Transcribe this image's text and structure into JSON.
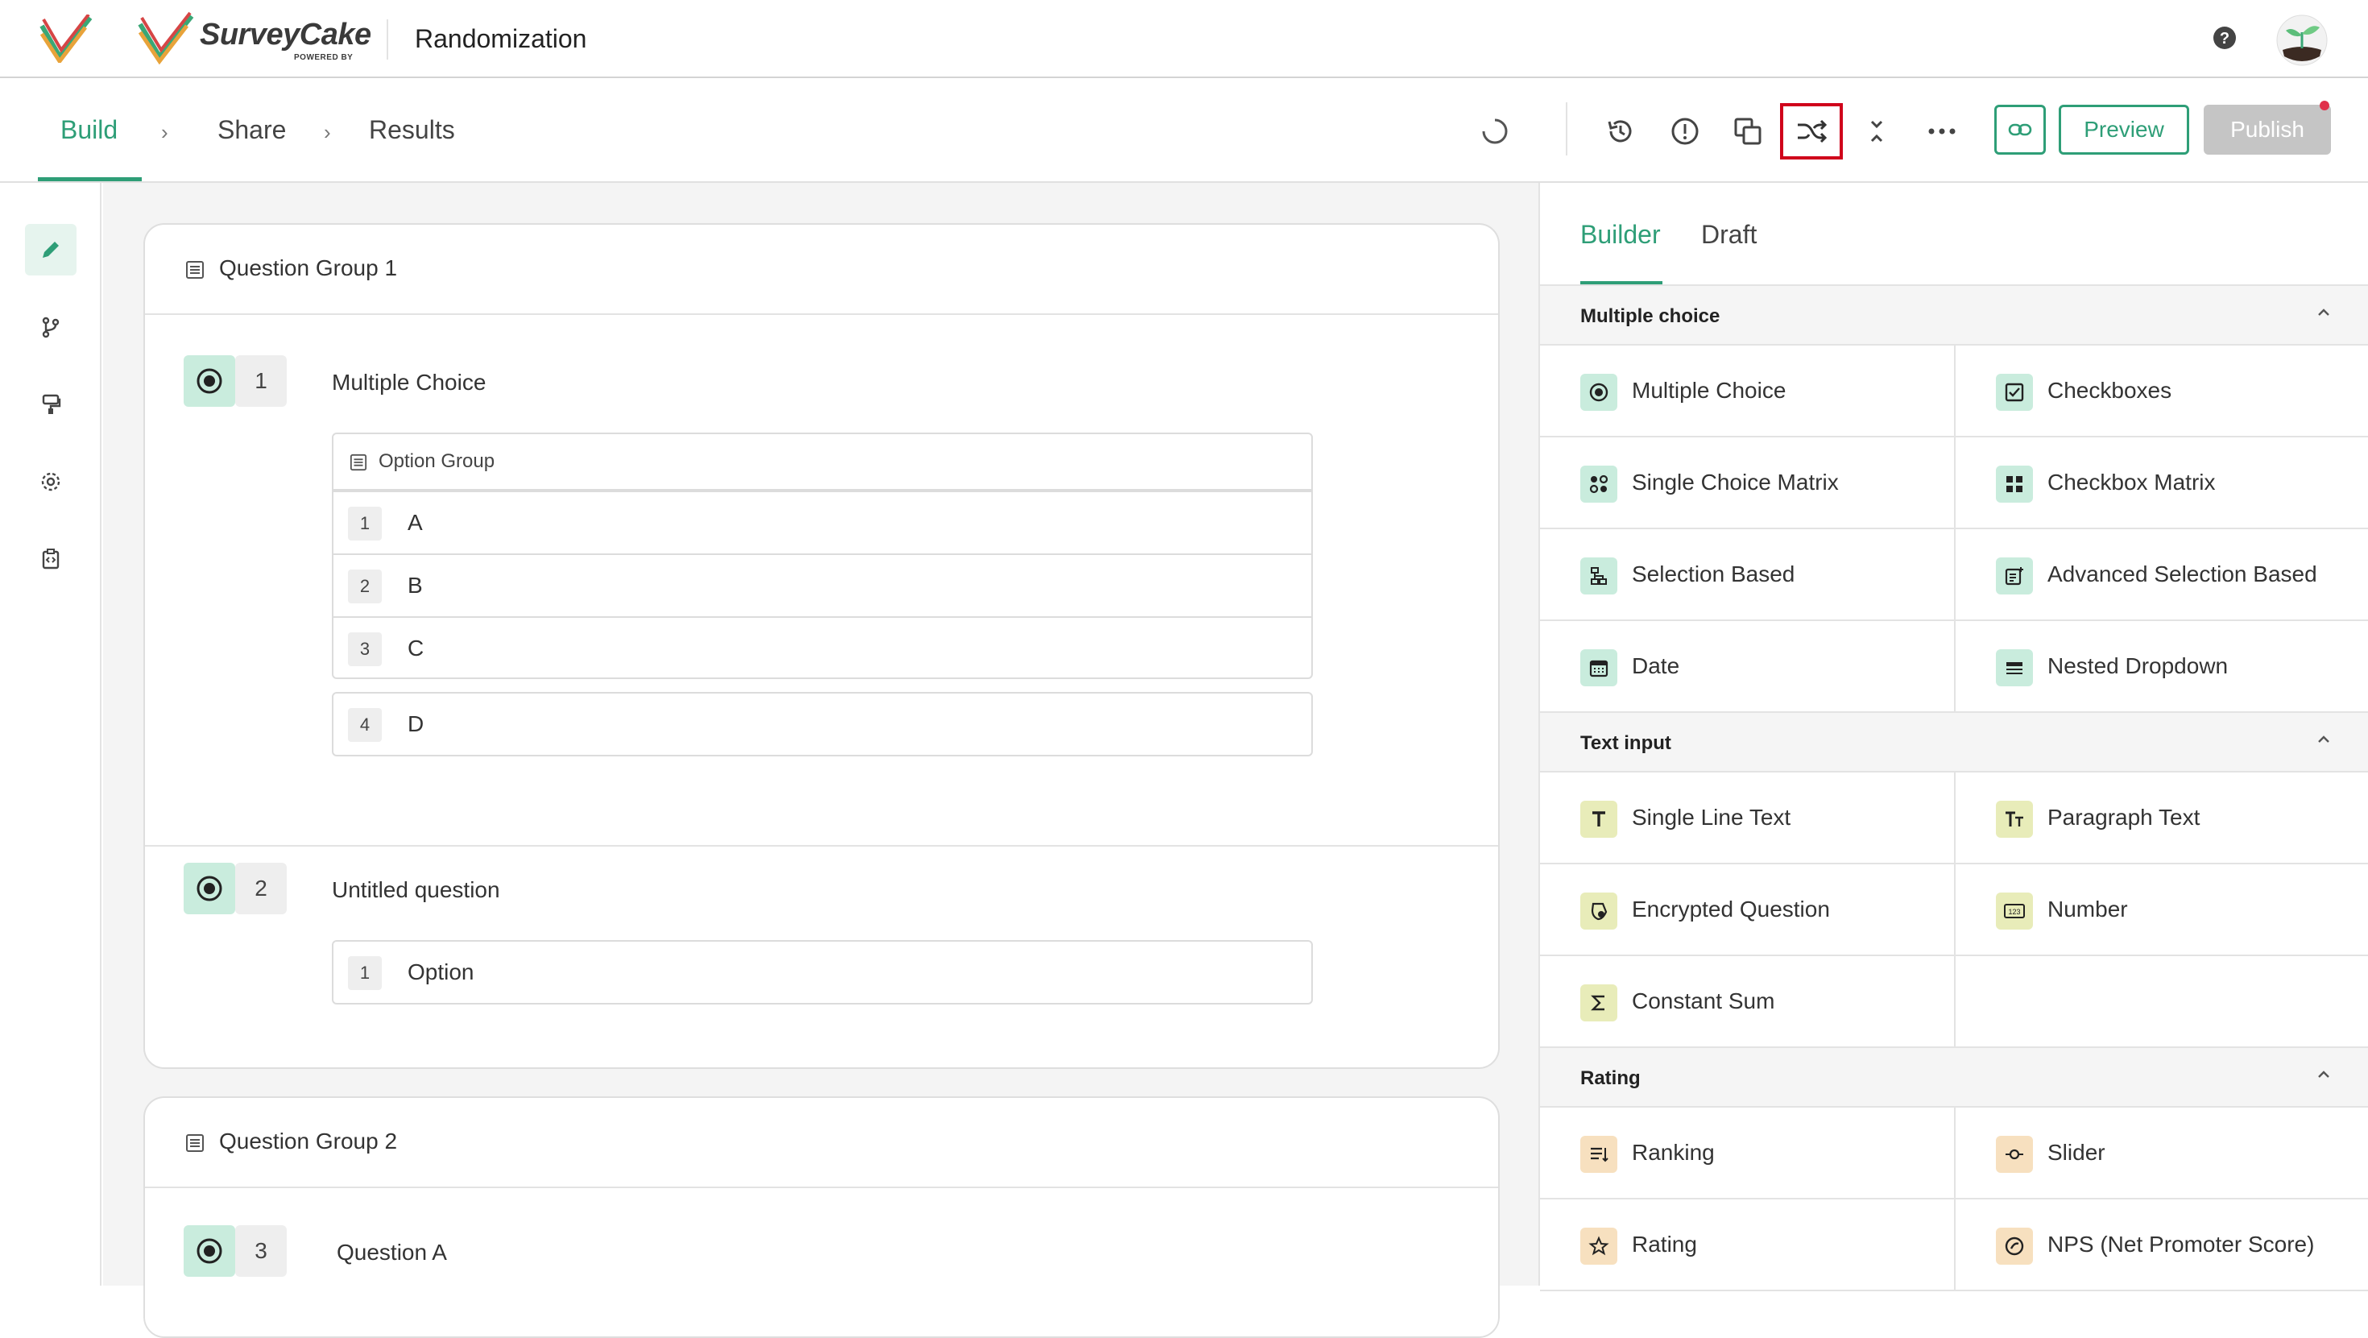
{
  "header": {
    "brand_name": "SurveyCake",
    "brand_sub": "POWERED BY",
    "page_title": "Randomization"
  },
  "nav": {
    "steps": [
      "Build",
      "Share",
      "Results"
    ],
    "preview_label": "Preview",
    "publish_label": "Publish"
  },
  "canvas": {
    "groups": [
      {
        "title": "Question Group 1",
        "questions": [
          {
            "number": "1",
            "title": "Multiple Choice",
            "option_group_label": "Option Group",
            "group_options": [
              {
                "num": "1",
                "text": "A"
              },
              {
                "num": "2",
                "text": "B"
              },
              {
                "num": "3",
                "text": "C"
              }
            ],
            "extra_option": {
              "num": "4",
              "text": "D"
            }
          },
          {
            "number": "2",
            "title": "Untitled question",
            "options": [
              {
                "num": "1",
                "text": "Option"
              }
            ]
          }
        ]
      },
      {
        "title": "Question Group 2",
        "questions": [
          {
            "number": "3",
            "title": "Question A"
          }
        ]
      }
    ]
  },
  "panel": {
    "tabs": [
      "Builder",
      "Draft"
    ],
    "sections": [
      {
        "title": "Multiple choice",
        "items": [
          "Multiple Choice",
          "Checkboxes",
          "Single Choice Matrix",
          "Checkbox Matrix",
          "Selection Based",
          "Advanced Selection Based",
          "Date",
          "Nested Dropdown"
        ]
      },
      {
        "title": "Text input",
        "items": [
          "Single Line Text",
          "Paragraph Text",
          "Encrypted Question",
          "Number",
          "Constant Sum"
        ]
      },
      {
        "title": "Rating",
        "items": [
          "Ranking",
          "Slider",
          "Rating",
          "NPS (Net Promoter Score)"
        ]
      }
    ]
  },
  "colors": {
    "accent": "#2e9e77",
    "highlight": "#d0021b"
  }
}
